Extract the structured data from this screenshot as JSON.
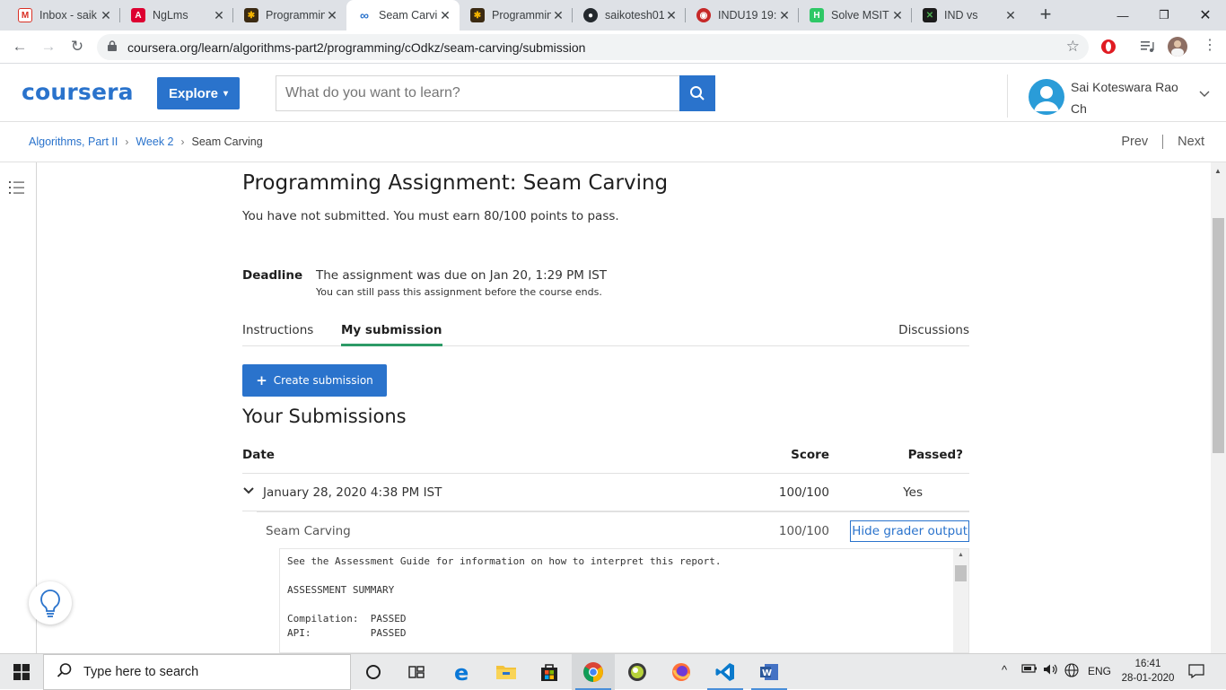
{
  "browser": {
    "tabs": [
      {
        "title": "Inbox - saik",
        "icon": "gmail-icon",
        "color": "#d93025",
        "glyph": "M"
      },
      {
        "title": "NgLms",
        "icon": "angular-icon",
        "color": "#dd0031",
        "glyph": "A"
      },
      {
        "title": "Programmin",
        "icon": "coursera-puzzle-icon",
        "color": "#f4b400",
        "glyph": "✱"
      },
      {
        "title": "Seam Carvir",
        "icon": "coursera-icon",
        "color": "#2a73cc",
        "glyph": "∞"
      },
      {
        "title": "Programmin",
        "icon": "coursera-puzzle-icon",
        "color": "#f4b400",
        "glyph": "✱"
      },
      {
        "title": "saikotesh01",
        "icon": "github-icon",
        "color": "#24292e",
        "glyph": "●"
      },
      {
        "title": "INDU19 19:",
        "icon": "cricket-icon",
        "color": "#c62828",
        "glyph": "◉"
      },
      {
        "title": "Solve MSIT",
        "icon": "hackerrank-icon",
        "color": "#2ec866",
        "glyph": "H"
      },
      {
        "title": "IND vs",
        "icon": "cricbuzz-icon",
        "color": "#1b1b1b",
        "glyph": "✕"
      }
    ],
    "url": "coursera.org/learn/algorithms-part2/programming/cOdkz/seam-carving/submission"
  },
  "header": {
    "logo": "coursera",
    "explore_label": "Explore",
    "search_placeholder": "What do you want to learn?",
    "user_name": "Sai Koteswara Rao Ch"
  },
  "breadcrumb": {
    "items": [
      "Algorithms, Part II",
      "Week 2",
      "Seam Carving"
    ],
    "prev": "Prev",
    "next": "Next"
  },
  "assignment": {
    "title": "Programming Assignment: Seam Carving",
    "status": "You have not submitted. You must earn 80/100 points to pass.",
    "deadline_label": "Deadline",
    "deadline_value": "The assignment was due on Jan 20, 1:29 PM IST",
    "deadline_note": "You can still pass this assignment before the course ends."
  },
  "tabs": {
    "instructions": "Instructions",
    "my_submission": "My submission",
    "discussions": "Discussions"
  },
  "submissions": {
    "create_label": "Create submission",
    "heading": "Your Submissions",
    "columns": {
      "date": "Date",
      "score": "Score",
      "passed": "Passed?"
    },
    "row": {
      "date": "January 28, 2020 4:38 PM IST",
      "score": "100/100",
      "passed": "Yes"
    },
    "part": {
      "name": "Seam Carving",
      "score": "100/100",
      "toggle": "Hide grader output"
    },
    "grader_output": "See the Assessment Guide for information on how to interpret this report.\n\nASSESSMENT SUMMARY\n\nCompilation:  PASSED\nAPI:          PASSED"
  },
  "taskbar": {
    "search_placeholder": "Type here to search",
    "language": "ENG",
    "time": "16:41",
    "date": "28-01-2020"
  },
  "colors": {
    "brand": "#2a73cc",
    "active_tab_underline": "#2d9b67"
  }
}
